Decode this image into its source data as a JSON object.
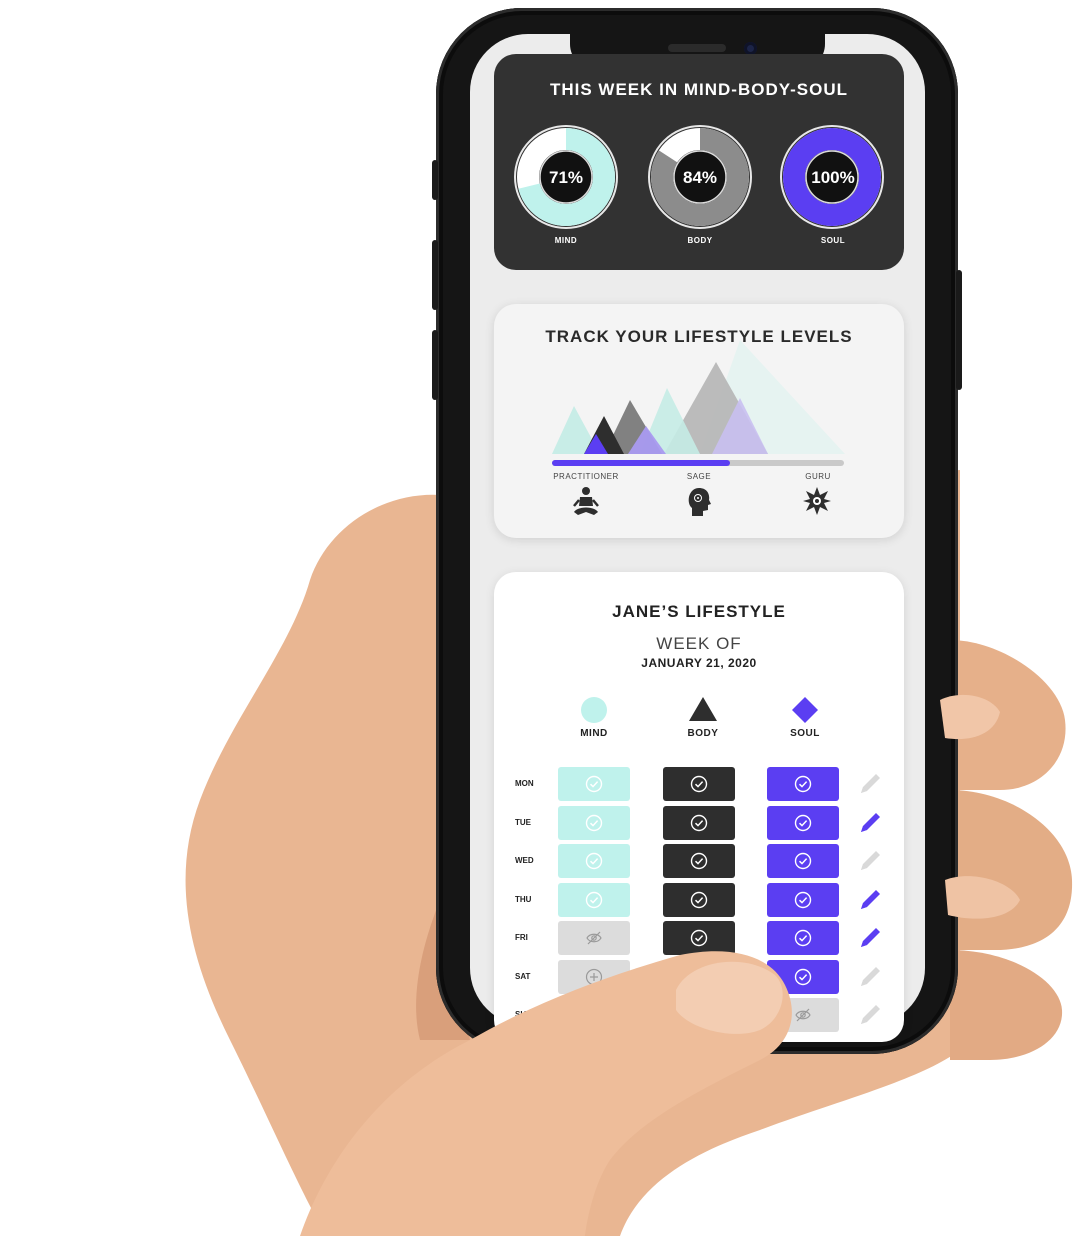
{
  "week_card": {
    "title": "THIS WEEK IN MIND-BODY-SOUL",
    "rings": [
      {
        "label": "MIND",
        "percent_text": "71%",
        "value": 71,
        "color": "#bff2ec"
      },
      {
        "label": "BODY",
        "percent_text": "84%",
        "value": 84,
        "color": "#8c8c8c"
      },
      {
        "label": "SOUL",
        "percent_text": "100%",
        "value": 100,
        "color": "#5b3ef2"
      }
    ]
  },
  "track_card": {
    "title": "TRACK YOUR LIFESTYLE LEVELS",
    "progress": 0.61,
    "levels": [
      {
        "label": "PRACTITIONER",
        "icon": "meditating-person-icon"
      },
      {
        "label": "SAGE",
        "icon": "head-profile-icon"
      },
      {
        "label": "GURU",
        "icon": "lotus-star-icon"
      }
    ]
  },
  "lifestyle_card": {
    "title": "JANE’S LIFESTYLE",
    "week_of": "WEEK OF",
    "date": "JANUARY 21, 2020",
    "columns": [
      {
        "label": "MIND",
        "shape": "circle",
        "color": "#bff2ec"
      },
      {
        "label": "BODY",
        "shape": "triangle",
        "color": "#2e2e2e"
      },
      {
        "label": "SOUL",
        "shape": "diamond",
        "color": "#5b3ef2"
      }
    ],
    "days": [
      {
        "day": "MON",
        "mind": "check",
        "body": "check",
        "soul": "check",
        "edit": "inactive"
      },
      {
        "day": "TUE",
        "mind": "check",
        "body": "check",
        "soul": "check",
        "edit": "active"
      },
      {
        "day": "WED",
        "mind": "check",
        "body": "check",
        "soul": "check",
        "edit": "inactive"
      },
      {
        "day": "THU",
        "mind": "check",
        "body": "check",
        "soul": "check",
        "edit": "active"
      },
      {
        "day": "FRI",
        "mind": "hidden",
        "body": "check",
        "soul": "check",
        "edit": "active"
      },
      {
        "day": "SAT",
        "mind": "add",
        "body": "check",
        "soul": "check",
        "edit": "inactive"
      },
      {
        "day": "SU",
        "mind": "",
        "body": "",
        "soul": "hidden",
        "edit": "inactive"
      }
    ]
  },
  "colors": {
    "mind": "#bff2ec",
    "body": "#2e2e2e",
    "soul": "#5b3ef2",
    "empty": "#dcdcdc"
  }
}
